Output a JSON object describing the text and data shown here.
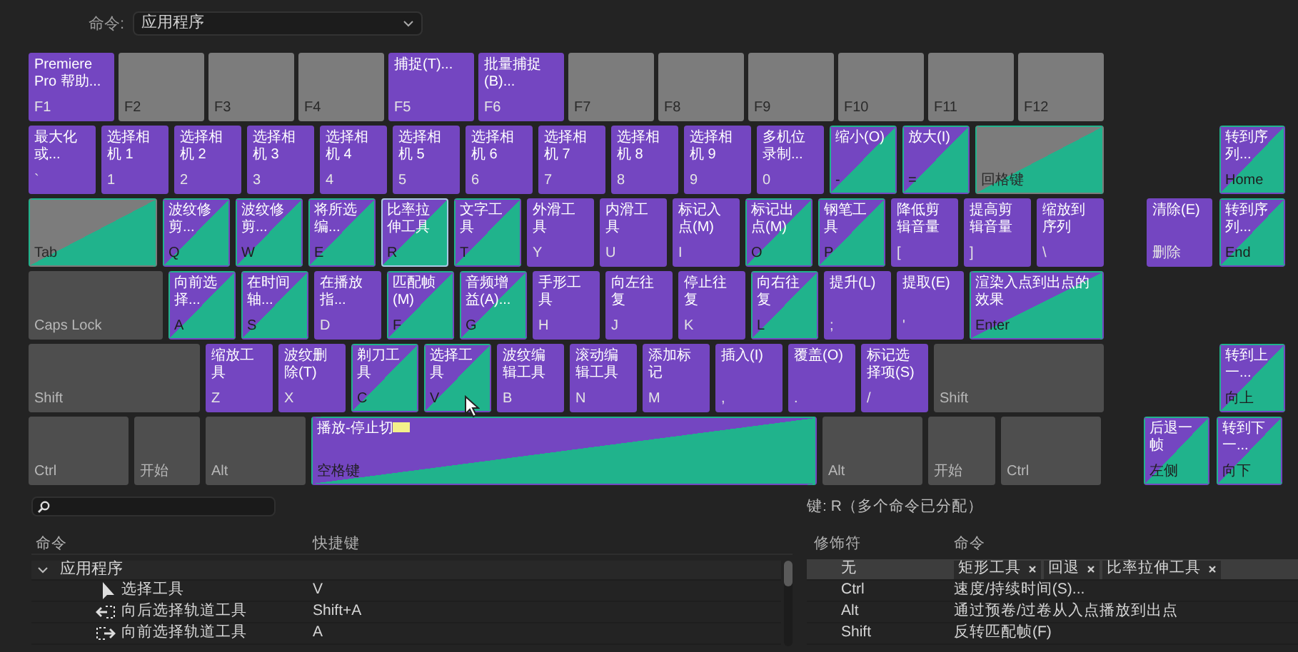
{
  "command_set": {
    "label": "命令:",
    "value": "应用程序"
  },
  "keyboard": {
    "rows": [
      {
        "keys": [
          {
            "kind": "app",
            "command": "Premiere Pro 帮助...",
            "label": "F1",
            "selected": false
          },
          {
            "kind": "unassigned",
            "label": "F2",
            "selected": false
          },
          {
            "kind": "unassigned",
            "label": "F3",
            "selected": false
          },
          {
            "kind": "unassigned",
            "label": "F4",
            "selected": false
          },
          {
            "kind": "app",
            "command": "捕捉(T)...",
            "label": "F5",
            "selected": false
          },
          {
            "kind": "app",
            "command": "批量捕捉(B)...",
            "label": "F6",
            "selected": false
          },
          {
            "kind": "unassigned",
            "label": "F7",
            "selected": false
          },
          {
            "kind": "unassigned",
            "label": "F8",
            "selected": false
          },
          {
            "kind": "unassigned",
            "label": "F9",
            "selected": false
          },
          {
            "kind": "unassigned",
            "label": "F10",
            "selected": false
          },
          {
            "kind": "unassigned",
            "label": "F11",
            "selected": false
          },
          {
            "kind": "unassigned",
            "label": "F12",
            "selected": false
          }
        ],
        "nav": []
      },
      {
        "keys": [
          {
            "kind": "app",
            "command": "最大化或...",
            "label": "`",
            "selected": false
          },
          {
            "kind": "app",
            "command": "选择相机 1",
            "label": "1",
            "selected": false
          },
          {
            "kind": "app",
            "command": "选择相机 2",
            "label": "2",
            "selected": false
          },
          {
            "kind": "app",
            "command": "选择相机 3",
            "label": "3",
            "selected": false
          },
          {
            "kind": "app",
            "command": "选择相机 4",
            "label": "4",
            "selected": false
          },
          {
            "kind": "app",
            "command": "选择相机 5",
            "label": "5",
            "selected": false
          },
          {
            "kind": "app",
            "command": "选择相机 6",
            "label": "6",
            "selected": false
          },
          {
            "kind": "app",
            "command": "选择相机 7",
            "label": "7",
            "selected": false
          },
          {
            "kind": "app",
            "command": "选择相机 8",
            "label": "8",
            "selected": false
          },
          {
            "kind": "app",
            "command": "选择相机 9",
            "label": "9",
            "selected": false
          },
          {
            "kind": "app",
            "command": "多机位录制...",
            "label": "0",
            "selected": false
          },
          {
            "kind": "mixed",
            "command": "缩小(O)",
            "label": "-",
            "selected": false
          },
          {
            "kind": "mixed",
            "command": "放大(I)",
            "label": "=",
            "selected": false
          },
          {
            "kind": "panel",
            "label": "回格键",
            "selected": false
          }
        ],
        "nav": [
          {
            "kind": "mixed",
            "command": "转到序列...",
            "label": "Home",
            "selected": false
          }
        ]
      },
      {
        "keys": [
          {
            "kind": "panel",
            "label": "Tab",
            "selected": false
          },
          {
            "kind": "mixed",
            "command": "波纹修剪...",
            "label": "Q",
            "selected": false
          },
          {
            "kind": "mixed",
            "command": "波纹修剪...",
            "label": "W",
            "selected": false
          },
          {
            "kind": "mixed",
            "command": "将所选编...",
            "label": "E",
            "selected": false
          },
          {
            "kind": "mixed",
            "command": "比率拉伸工具",
            "label": "R",
            "selected": true
          },
          {
            "kind": "mixed",
            "command": "文字工具",
            "label": "T",
            "selected": false
          },
          {
            "kind": "app",
            "command": "外滑工具",
            "label": "Y",
            "selected": false
          },
          {
            "kind": "app",
            "command": "内滑工具",
            "label": "U",
            "selected": false
          },
          {
            "kind": "app",
            "command": "标记入点(M)",
            "label": "I",
            "selected": false
          },
          {
            "kind": "mixed",
            "command": "标记出点(M)",
            "label": "O",
            "selected": false
          },
          {
            "kind": "mixed",
            "command": "钢笔工具",
            "label": "P",
            "selected": false
          },
          {
            "kind": "app",
            "command": "降低剪辑音量",
            "label": "[",
            "selected": false
          },
          {
            "kind": "app",
            "command": "提高剪辑音量",
            "label": "]",
            "selected": false
          },
          {
            "kind": "app",
            "command": "缩放到序列",
            "label": "\\",
            "selected": false
          }
        ],
        "nav": [
          {
            "kind": "app",
            "command": "清除(E)",
            "label": "删除",
            "selected": false
          },
          {
            "kind": "mixed",
            "command": "转到序列...",
            "label": "End",
            "selected": false
          }
        ]
      },
      {
        "keys": [
          {
            "kind": "modifier",
            "label": "Caps Lock",
            "selected": false
          },
          {
            "kind": "mixed",
            "command": "向前选择...",
            "label": "A",
            "selected": false
          },
          {
            "kind": "mixed",
            "command": "在时间轴...",
            "label": "S",
            "selected": false
          },
          {
            "kind": "app",
            "command": "在播放指...",
            "label": "D",
            "selected": false
          },
          {
            "kind": "mixed",
            "command": "匹配帧(M)",
            "label": "F",
            "selected": false
          },
          {
            "kind": "mixed",
            "command": "音频增益(A)...",
            "label": "G",
            "selected": false
          },
          {
            "kind": "app",
            "command": "手形工具",
            "label": "H",
            "selected": false
          },
          {
            "kind": "app",
            "command": "向左往复",
            "label": "J",
            "selected": false
          },
          {
            "kind": "app",
            "command": "停止往复",
            "label": "K",
            "selected": false
          },
          {
            "kind": "mixed",
            "command": "向右往复",
            "label": "L",
            "selected": false
          },
          {
            "kind": "app",
            "command": "提升(L)",
            "label": ";",
            "selected": false
          },
          {
            "kind": "app",
            "command": "提取(E)",
            "label": "'",
            "selected": false
          },
          {
            "kind": "mixed",
            "command": "渲染入点到出点的效果",
            "label": "Enter",
            "selected": false
          }
        ],
        "nav": []
      },
      {
        "keys": [
          {
            "kind": "modifier",
            "label": "Shift",
            "selected": false
          },
          {
            "kind": "app",
            "command": "缩放工具",
            "label": "Z",
            "selected": false
          },
          {
            "kind": "app",
            "command": "波纹删除(T)",
            "label": "X",
            "selected": false
          },
          {
            "kind": "mixed",
            "command": "剃刀工具",
            "label": "C",
            "selected": false
          },
          {
            "kind": "mixed",
            "command": "选择工具",
            "label": "V",
            "selected": false
          },
          {
            "kind": "app",
            "command": "波纹编辑工具",
            "label": "B",
            "selected": false
          },
          {
            "kind": "app",
            "command": "滚动编辑工具",
            "label": "N",
            "selected": false
          },
          {
            "kind": "app",
            "command": "添加标记",
            "label": "M",
            "selected": false
          },
          {
            "kind": "app",
            "command": "插入(I)",
            "label": ",",
            "selected": false
          },
          {
            "kind": "app",
            "command": "覆盖(O)",
            "label": ".",
            "selected": false
          },
          {
            "kind": "app",
            "command": "标记选择项(S)",
            "label": "/",
            "selected": false
          },
          {
            "kind": "modifier",
            "label": "Shift",
            "selected": false
          }
        ],
        "nav": [
          {
            "kind": "mixed",
            "command": "转到上一...",
            "label": "向上",
            "selected": false
          }
        ]
      },
      {
        "keys": [
          {
            "kind": "modifier",
            "label": "Ctrl",
            "selected": false
          },
          {
            "kind": "modifier",
            "label": "开始",
            "selected": false
          },
          {
            "kind": "modifier",
            "label": "Alt",
            "selected": false
          },
          {
            "kind": "mixed",
            "command": "播放-停止切",
            "label": "空格键",
            "selected": false
          },
          {
            "kind": "modifier",
            "label": "Alt",
            "selected": false
          },
          {
            "kind": "modifier",
            "label": "开始",
            "selected": false
          },
          {
            "kind": "modifier",
            "label": "Ctrl",
            "selected": false
          }
        ],
        "nav": [
          {
            "kind": "mixed",
            "command": "后退一帧",
            "label": "左侧",
            "selected": false
          },
          {
            "kind": "mixed",
            "command": "转到下一...",
            "label": "向下",
            "selected": false
          }
        ]
      }
    ]
  },
  "command_list": {
    "columns": [
      "命令",
      "快捷键"
    ],
    "groups": [
      {
        "label": "应用程序",
        "expanded": true,
        "children": [
          {
            "label": "选择工具",
            "shortcut": "V"
          },
          {
            "label": "向后选择轨道工具",
            "shortcut": "Shift+A"
          },
          {
            "label": "向前选择轨道工具",
            "shortcut": "A"
          }
        ]
      }
    ]
  },
  "key_detail": {
    "title": "键: R（多个命令已分配）",
    "columns": [
      "修饰符",
      "命令"
    ],
    "rows": [
      {
        "modifier": "无",
        "selected": true,
        "commands": [
          "矩形工具",
          "回退",
          "比率拉伸工具"
        ]
      },
      {
        "modifier": "Ctrl",
        "selected": false,
        "commands": [
          "速度/持续时间(S)..."
        ]
      },
      {
        "modifier": "Alt",
        "selected": false,
        "commands": [
          "通过预卷/过卷从入点播放到出点"
        ]
      },
      {
        "modifier": "Shift",
        "selected": false,
        "commands": [
          "反转匹配帧(F)"
        ]
      }
    ]
  }
}
